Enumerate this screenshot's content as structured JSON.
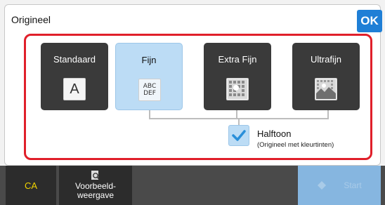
{
  "dialog": {
    "title": "Origineel",
    "ok_label": "OK"
  },
  "options": [
    {
      "label": "Standaard",
      "icon": "letter-a-icon",
      "icon_text": "A",
      "selected": false
    },
    {
      "label": "Fijn",
      "icon": "abc-def-icon",
      "icon_text": "ABC\nDEF",
      "selected": true
    },
    {
      "label": "Extra Fijn",
      "icon": "fine-pattern-icon",
      "selected": false
    },
    {
      "label": "Ultrafijn",
      "icon": "photo-pattern-icon",
      "selected": false
    }
  ],
  "halftone": {
    "label": "Halftoon",
    "sublabel": "(Origineel met kleurtinten)",
    "checked": true
  },
  "bottom": {
    "ca_label": "CA",
    "preview_label": "Voorbeeld-\nweergave",
    "start_label": "Start"
  },
  "colors": {
    "accent": "#1f7fd6",
    "selected": "#bcdcf5",
    "highlight": "#e01f2a",
    "ca_text": "#f2d400"
  }
}
